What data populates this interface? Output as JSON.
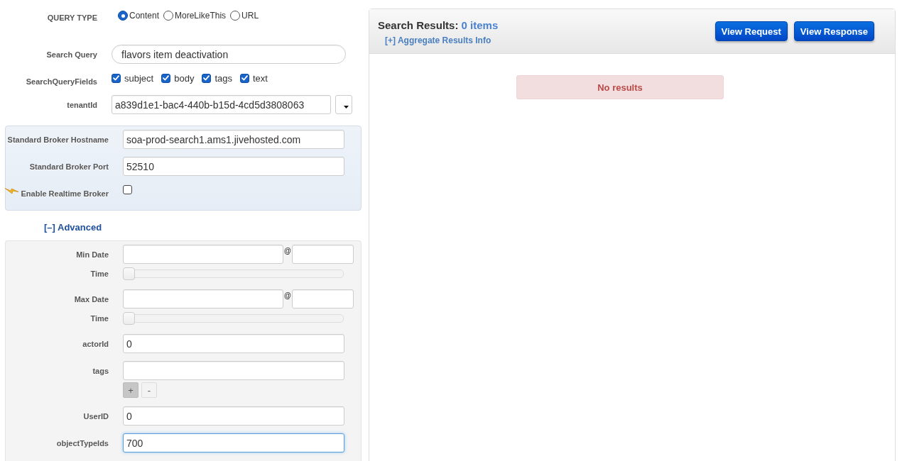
{
  "query_type": {
    "label": "QUERY TYPE",
    "options": [
      {
        "label": "Content",
        "selected": true
      },
      {
        "label": "MoreLikeThis",
        "selected": false
      },
      {
        "label": "URL",
        "selected": false
      }
    ]
  },
  "search_query": {
    "label": "Search Query",
    "value": "flavors item deactivation"
  },
  "search_query_fields": {
    "label": "SearchQueryFields",
    "options": [
      {
        "label": "subject",
        "checked": true
      },
      {
        "label": "body",
        "checked": true
      },
      {
        "label": "tags",
        "checked": true
      },
      {
        "label": "text",
        "checked": true
      }
    ]
  },
  "tenant_id": {
    "label": "tenantId",
    "value": "a839d1e1-bac4-440b-b15d-4cd5d3808063"
  },
  "broker": {
    "fields": [
      {
        "kind": "text",
        "label": "Standard Broker Hostname",
        "value": "soa-prod-search1.ams1.jivehosted.com",
        "focused": false
      },
      {
        "kind": "text",
        "label": "Standard Broker Port",
        "value": "52510",
        "focused": false
      },
      {
        "kind": "checkbox",
        "label": "Enable Realtime Broker",
        "checked": false
      }
    ]
  },
  "advanced": {
    "toggle": "[–] Advanced",
    "fields": [
      {
        "kind": "date",
        "label": "Min Date",
        "separator": "@",
        "time_label": "Time",
        "level": 0
      },
      {
        "kind": "date",
        "label": "Max Date",
        "separator": "@",
        "time_label": "Time",
        "level": 0
      },
      {
        "kind": "text",
        "label": "actorId",
        "value": "0",
        "focused": false
      },
      {
        "kind": "list",
        "label": "tags",
        "buttons": [
          {
            "label": "+",
            "pressed": true
          },
          {
            "label": "-",
            "pressed": false
          }
        ]
      },
      {
        "kind": "text",
        "label": "UserID",
        "value": "0",
        "focused": false
      },
      {
        "kind": "text",
        "label": "objectTypeIds",
        "value": "700",
        "focused": true
      }
    ]
  },
  "results": {
    "title": "Search Results:",
    "count": "0 items",
    "aggregate_link": "[+] Aggregate Results Info",
    "buttons": [
      "View Request",
      "View Response"
    ],
    "message": "No results"
  }
}
